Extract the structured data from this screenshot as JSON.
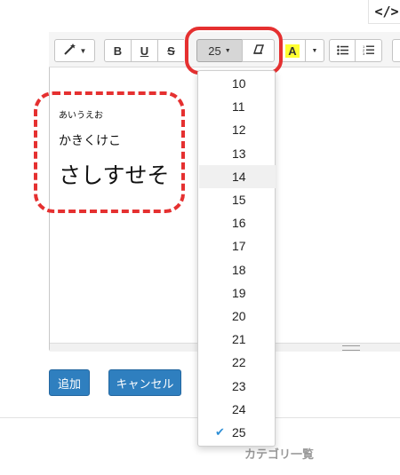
{
  "codeview": {
    "icon": "code-icon",
    "label": "</>"
  },
  "toolbar": {
    "magic_icon": "magic-wand-icon",
    "bold": "B",
    "underline": "U",
    "strike": "S",
    "fontsize_value": "25",
    "eraser_icon": "eraser-icon",
    "highlight": "A",
    "ul_icon": "unordered-list-icon",
    "ol_icon": "ordered-list-icon",
    "highlight_color": "#ffff33"
  },
  "content": {
    "line1": "あいうえお",
    "line2": "かきくけこ",
    "line3": "さしすせそ"
  },
  "fontsize_menu": {
    "items": [
      "10",
      "11",
      "12",
      "13",
      "14",
      "15",
      "16",
      "17",
      "18",
      "19",
      "20",
      "21",
      "22",
      "23",
      "24",
      "25"
    ],
    "selected": "25",
    "hovered": "14"
  },
  "buttons": {
    "add": "追加",
    "cancel": "キャンセル"
  },
  "footer": {
    "category_link": "カテゴリ一覧"
  },
  "colors": {
    "accent": "#2f7fbf",
    "annotation": "#e53030",
    "check": "#2e8fd6"
  }
}
